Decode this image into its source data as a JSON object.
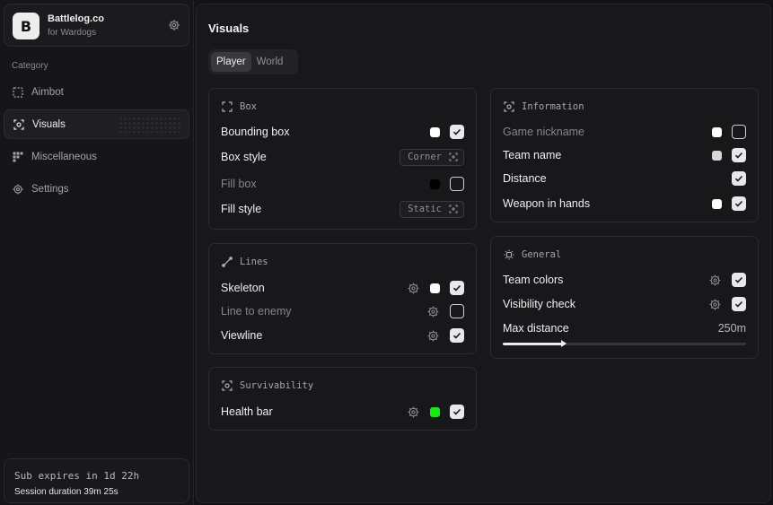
{
  "brand": {
    "logo_letter": "B",
    "name": "Battlelog.co",
    "subtitle": "for Wardogs",
    "settings_icon": "gear-icon"
  },
  "sidebar": {
    "category_label": "Category",
    "items": [
      {
        "label": "Aimbot",
        "icon": "crosshair-frame-icon",
        "active": false
      },
      {
        "label": "Visuals",
        "icon": "eye-scan-icon",
        "active": true
      },
      {
        "label": "Miscellaneous",
        "icon": "grid-misc-icon",
        "active": false
      },
      {
        "label": "Settings",
        "icon": "gear-icon",
        "active": false
      }
    ],
    "subscription": {
      "expires": "Sub expires in 1d 22h",
      "session": "Session duration 39m 25s"
    }
  },
  "main": {
    "title": "Visuals",
    "tabs": [
      {
        "label": "Player",
        "active": true
      },
      {
        "label": "World",
        "active": false
      }
    ]
  },
  "cards": {
    "box": {
      "title": "Box",
      "rows": [
        {
          "label": "Bounding box",
          "swatch": "#ffffff",
          "checked": true
        },
        {
          "label": "Box style",
          "select": "Corner"
        },
        {
          "label": "Fill box",
          "swatch": "#000000",
          "checked": false,
          "dim": true
        },
        {
          "label": "Fill style",
          "select": "Static"
        }
      ]
    },
    "lines": {
      "title": "Lines",
      "rows": [
        {
          "label": "Skeleton",
          "swatch": "#ffffff",
          "checked": true
        },
        {
          "label": "Line to enemy",
          "checked": false,
          "dim": true
        },
        {
          "label": "Viewline",
          "checked": true
        }
      ]
    },
    "survivability": {
      "title": "Survivability",
      "rows": [
        {
          "label": "Health bar",
          "swatch": "#17e817",
          "checked": true
        }
      ]
    },
    "information": {
      "title": "Information",
      "rows": [
        {
          "label": "Game nickname",
          "swatch": "#ffffff",
          "checked": false,
          "dim": true
        },
        {
          "label": "Team name",
          "swatch": "#d6d6d6",
          "checked": true
        },
        {
          "label": "Distance",
          "checked": true
        },
        {
          "label": "Weapon in hands",
          "swatch": "#ffffff",
          "checked": true
        }
      ]
    },
    "general": {
      "title": "General",
      "rows": [
        {
          "label": "Team colors",
          "checked": true
        },
        {
          "label": "Visibility check",
          "checked": true
        }
      ],
      "max_distance": {
        "label": "Max distance",
        "value": "250m",
        "fraction": 0.25
      }
    }
  }
}
